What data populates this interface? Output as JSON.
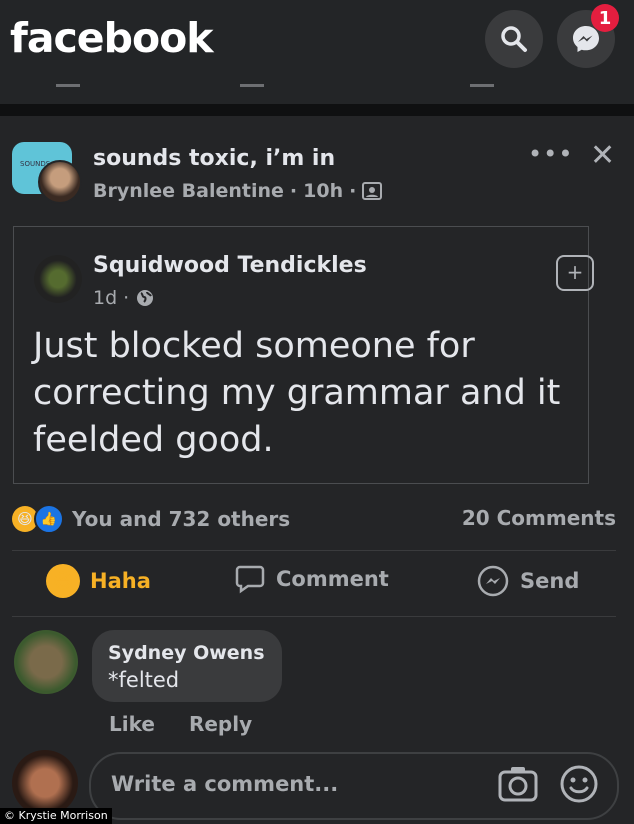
{
  "header": {
    "logo": "facebook",
    "messenger_badge": "1",
    "search_icon": "search-icon",
    "messenger_icon": "messenger-icon"
  },
  "post": {
    "page_avatar_text": "SOUNDS",
    "title": "sounds toxic, i’m in",
    "author": "Brynlee Balentine",
    "time": "10h",
    "shared": {
      "name": "Squidwood Tendickles",
      "time": "1d",
      "text": "Just blocked someone for correcting my grammar and it feelded good."
    },
    "reactions_text": "You and 732 others",
    "comments_count": "20 Comments",
    "actions": {
      "haha": "Haha",
      "comment": "Comment",
      "send": "Send"
    }
  },
  "comment": {
    "name": "Sydney Owens",
    "text": "*felted",
    "like": "Like",
    "reply": "Reply"
  },
  "composer": {
    "placeholder": "Write a comment..."
  },
  "credit": "© Krystie Morrison",
  "colors": {
    "background": "#242527",
    "haha": "#f7b125",
    "like": "#1b74e4",
    "badge": "#e41e3f"
  }
}
